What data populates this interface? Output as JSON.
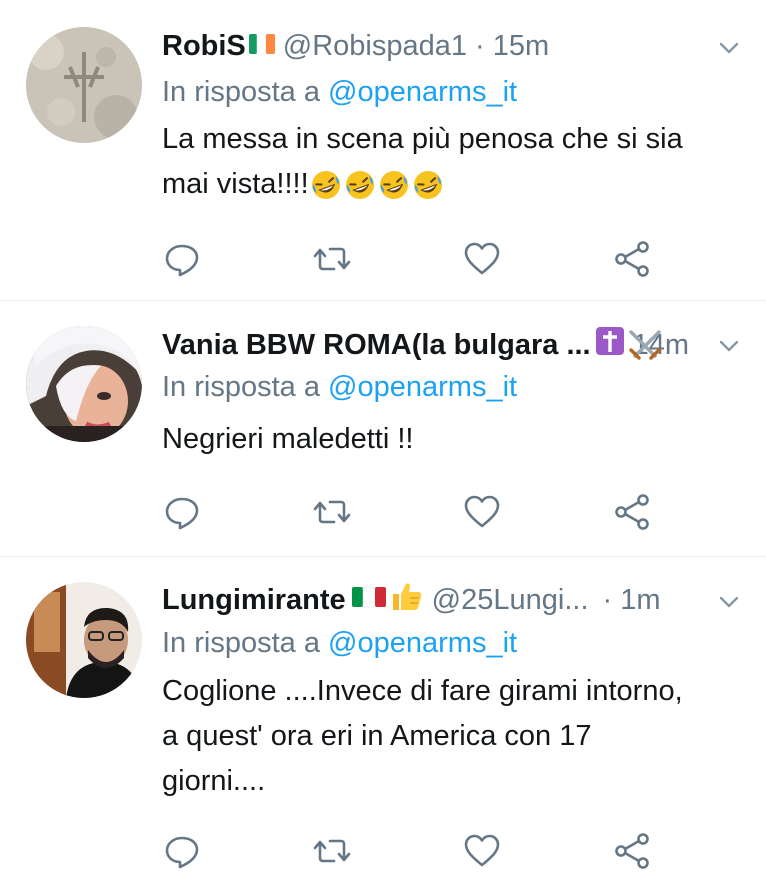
{
  "tweets": [
    {
      "name": "RobiS",
      "handle": "@Robispada1",
      "time": "· 15m",
      "reply_prefix": "In risposta a",
      "reply_to": "@openarms_it",
      "text_lines": [
        "La messa in scena più penosa che si sia",
        "mai vista!!!!"
      ]
    },
    {
      "name": "Vania BBW ROMA(la bulgara ...",
      "handle": "",
      "time": "14m",
      "reply_prefix": "In risposta a",
      "reply_to": "@openarms_it",
      "text_lines": [
        "Negrieri maledetti !!"
      ]
    },
    {
      "name": "Lungimirante",
      "handle": "@25Lungi...",
      "time": "· 1m",
      "reply_prefix": "In risposta a",
      "reply_to": "@openarms_it",
      "text_lines": [
        "Coglione ....Invece di fare girami intorno,",
        "a quest' ora eri in America con 17",
        "giorni...."
      ]
    }
  ],
  "icons": {
    "reply": "reply-icon",
    "retweet": "retweet-icon",
    "like": "heart-icon",
    "share": "share-icon",
    "caret": "chevron-down-icon"
  },
  "colors": {
    "link": "#1da1f2",
    "muted": "#657786",
    "text": "#14171a",
    "separator": "#e6ecf0"
  }
}
